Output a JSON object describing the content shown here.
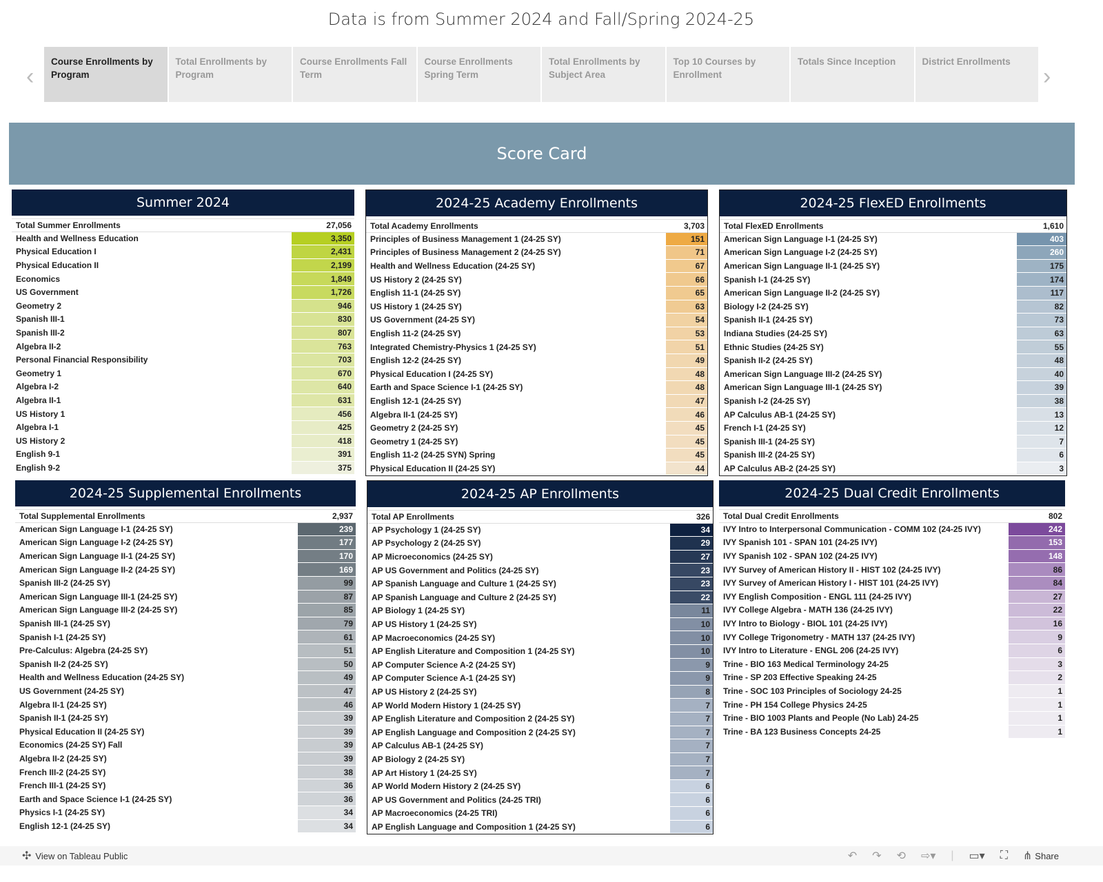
{
  "title": "Data is from Summer 2024 and Fall/Spring 2024-25",
  "tabs": [
    "Course Enrollments by Program",
    "Total Enrollments by Program",
    "Course Enrollments Fall Term",
    "Course Enrollments Spring Term",
    "Total Enrollments  by Subject Area",
    "Top 10 Courses by Enrollment",
    "Totals Since Inception",
    "District Enrollments"
  ],
  "banner": "Score Card",
  "colors": {
    "summer": [
      "#eef0de",
      "#b6cf22"
    ],
    "academy": [
      "#f2e3cc",
      "#eeaa44"
    ],
    "flexed": [
      "#eaedf1",
      "#7694ad"
    ],
    "supplemental": [
      "#dcdfe2",
      "#5c6870"
    ],
    "ap": [
      "#c8d2e0",
      "#0e2140"
    ],
    "dual": [
      "#eeebf1",
      "#7c4a9c"
    ]
  },
  "panels": [
    {
      "key": "summer",
      "title": "Summer 2024",
      "total_label": "Total Summer Enrollments",
      "total": "27,056",
      "rows": [
        [
          "Health and Wellness Education",
          "3,350"
        ],
        [
          "Physical Education I",
          "2,431"
        ],
        [
          "Physical Education II",
          "2,199"
        ],
        [
          "Economics",
          "1,849"
        ],
        [
          "US Government",
          "1,726"
        ],
        [
          "Geometry 2",
          "946"
        ],
        [
          "Spanish III-1",
          "830"
        ],
        [
          "Spanish III-2",
          "807"
        ],
        [
          "Algebra II-2",
          "763"
        ],
        [
          "Personal Financial Responsibility",
          "703"
        ],
        [
          "Geometry 1",
          "670"
        ],
        [
          "Algebra I-2",
          "640"
        ],
        [
          "Algebra II-1",
          "631"
        ],
        [
          "US History 1",
          "456"
        ],
        [
          "Algebra I-1",
          "425"
        ],
        [
          "US History 2",
          "418"
        ],
        [
          "English 9-1",
          "391"
        ],
        [
          "English 9-2",
          "375"
        ]
      ]
    },
    {
      "key": "academy",
      "title": "2024-25 Academy Enrollments",
      "total_label": "Total Academy Enrollments",
      "total": "3,703",
      "rows": [
        [
          "Principles of Business Management 1 (24-25 SY)",
          "151"
        ],
        [
          "Principles of Business Management 2 (24-25 SY)",
          "71"
        ],
        [
          "Health and Wellness Education (24-25 SY)",
          "67"
        ],
        [
          "US History 2 (24-25 SY)",
          "66"
        ],
        [
          "English 11-1 (24-25 SY)",
          "65"
        ],
        [
          "US History 1 (24-25 SY)",
          "63"
        ],
        [
          "US Government (24-25 SY)",
          "54"
        ],
        [
          "English 11-2 (24-25 SY)",
          "53"
        ],
        [
          "Integrated Chemistry-Physics 1 (24-25 SY)",
          "51"
        ],
        [
          "English 12-2 (24-25 SY)",
          "49"
        ],
        [
          "Physical Education I (24-25 SY)",
          "48"
        ],
        [
          "Earth and Space Science I-1 (24-25 SY)",
          "48"
        ],
        [
          "English 12-1 (24-25 SY)",
          "47"
        ],
        [
          "Algebra II-1 (24-25 SY)",
          "46"
        ],
        [
          "Geometry 2 (24-25 SY)",
          "45"
        ],
        [
          "Geometry 1 (24-25 SY)",
          "45"
        ],
        [
          "English 11-2 (24-25 SYN) Spring",
          "45"
        ],
        [
          "Physical Education II (24-25 SY)",
          "44"
        ]
      ]
    },
    {
      "key": "flexed",
      "title": "2024-25 FlexED Enrollments",
      "total_label": "Total FlexED Enrollments",
      "total": "1,610",
      "rows": [
        [
          "American Sign Language I-1 (24-25 SY)",
          "403"
        ],
        [
          "American Sign Language I-2 (24-25 SY)",
          "260"
        ],
        [
          "American Sign Language II-1 (24-25 SY)",
          "175"
        ],
        [
          "Spanish I-1 (24-25 SY)",
          "174"
        ],
        [
          "American Sign Language II-2 (24-25 SY)",
          "117"
        ],
        [
          "Biology I-2 (24-25 SY)",
          "82"
        ],
        [
          "Spanish II-1 (24-25 SY)",
          "73"
        ],
        [
          "Indiana Studies (24-25 SY)",
          "63"
        ],
        [
          "Ethnic Studies (24-25 SY)",
          "55"
        ],
        [
          "Spanish II-2 (24-25 SY)",
          "48"
        ],
        [
          "American Sign Language III-2 (24-25 SY)",
          "40"
        ],
        [
          "American Sign Language III-1 (24-25 SY)",
          "39"
        ],
        [
          "Spanish I-2 (24-25 SY)",
          "38"
        ],
        [
          "AP Calculus AB-1 (24-25 SY)",
          "13"
        ],
        [
          "French I-1 (24-25 SY)",
          "12"
        ],
        [
          "Spanish III-1 (24-25 SY)",
          "7"
        ],
        [
          "Spanish III-2 (24-25 SY)",
          "6"
        ],
        [
          "AP Calculus AB-2 (24-25 SY)",
          "3"
        ]
      ]
    },
    {
      "key": "supplemental",
      "title": "2024-25 Supplemental Enrollments",
      "total_label": "Total Supplemental Enrollments",
      "total": "2,937",
      "rows": [
        [
          "American Sign Language I-1 (24-25 SY)",
          "239"
        ],
        [
          "American Sign Language I-2 (24-25 SY)",
          "177"
        ],
        [
          "American Sign Language II-1 (24-25 SY)",
          "170"
        ],
        [
          "American Sign Language II-2 (24-25 SY)",
          "169"
        ],
        [
          "Spanish III-2 (24-25 SY)",
          "99"
        ],
        [
          "American Sign Language III-1 (24-25 SY)",
          "87"
        ],
        [
          "American Sign Language III-2 (24-25 SY)",
          "85"
        ],
        [
          "Spanish III-1 (24-25 SY)",
          "79"
        ],
        [
          "Spanish I-1 (24-25 SY)",
          "61"
        ],
        [
          "Pre-Calculus: Algebra (24-25 SY)",
          "51"
        ],
        [
          "Spanish II-2 (24-25 SY)",
          "50"
        ],
        [
          "Health and Wellness Education (24-25 SY)",
          "49"
        ],
        [
          "US Government (24-25 SY)",
          "47"
        ],
        [
          "Algebra II-1 (24-25 SY)",
          "46"
        ],
        [
          "Spanish II-1 (24-25 SY)",
          "39"
        ],
        [
          "Physical Education II (24-25 SY)",
          "39"
        ],
        [
          "Economics (24-25 SY) Fall",
          "39"
        ],
        [
          "Algebra II-2 (24-25 SY)",
          "39"
        ],
        [
          "French III-2 (24-25 SY)",
          "38"
        ],
        [
          "French III-1 (24-25 SY)",
          "36"
        ],
        [
          "Earth and Space Science I-1 (24-25 SY)",
          "36"
        ],
        [
          "Physics I-1 (24-25 SY)",
          "34"
        ],
        [
          "English 12-1 (24-25 SY)",
          "34"
        ]
      ]
    },
    {
      "key": "ap",
      "title": "2024-25 AP Enrollments",
      "total_label": "Total AP Enrollments",
      "total": "326",
      "rows": [
        [
          "AP Psychology 1 (24-25 SY)",
          "34"
        ],
        [
          "AP Psychology 2 (24-25 SY)",
          "29"
        ],
        [
          "AP Microeconomics (24-25 SY)",
          "27"
        ],
        [
          "AP US Government and Politics (24-25 SY)",
          "23"
        ],
        [
          "AP Spanish Language and Culture 1 (24-25 SY)",
          "23"
        ],
        [
          "AP Spanish Language and Culture 2 (24-25 SY)",
          "22"
        ],
        [
          "AP Biology 1 (24-25 SY)",
          "11"
        ],
        [
          "AP US History 1 (24-25 SY)",
          "10"
        ],
        [
          "AP Macroeconomics (24-25 SY)",
          "10"
        ],
        [
          "AP English Literature and Composition 1 (24-25 SY)",
          "10"
        ],
        [
          "AP Computer Science A-2 (24-25 SY)",
          "9"
        ],
        [
          "AP Computer Science A-1 (24-25 SY)",
          "9"
        ],
        [
          "AP US History 2 (24-25 SY)",
          "8"
        ],
        [
          "AP World Modern History 1 (24-25 SY)",
          "7"
        ],
        [
          "AP English Literature and Composition 2 (24-25 SY)",
          "7"
        ],
        [
          "AP English Language and Composition 2 (24-25 SY)",
          "7"
        ],
        [
          "AP Calculus AB-1 (24-25 SY)",
          "7"
        ],
        [
          "AP Biology 2 (24-25 SY)",
          "7"
        ],
        [
          "AP Art History 1 (24-25 SY)",
          "7"
        ],
        [
          "AP World Modern History 2 (24-25 SY)",
          "6"
        ],
        [
          "AP US Government and Politics (24-25 TRI)",
          "6"
        ],
        [
          "AP Macroeconomics (24-25 TRI)",
          "6"
        ],
        [
          "AP English Language and Composition 1 (24-25 SY)",
          "6"
        ]
      ]
    },
    {
      "key": "dual",
      "title": "2024-25 Dual Credit Enrollments",
      "total_label": "Total Dual Credit Enrollments",
      "total": "802",
      "rows": [
        [
          "IVY Intro to Interpersonal Communication - COMM 102 (24-25 IVY)",
          "242"
        ],
        [
          "IVY Spanish 101 - SPAN 101 (24-25 IVY)",
          "153"
        ],
        [
          "IVY Spanish 102 - SPAN 102 (24-25 IVY)",
          "148"
        ],
        [
          "IVY Survey of American History II - HIST 102 (24-25 IVY)",
          "86"
        ],
        [
          "IVY Survey of American History I - HIST 101 (24-25 IVY)",
          "84"
        ],
        [
          "IVY English Composition - ENGL 111 (24-25 IVY)",
          "27"
        ],
        [
          "IVY College Algebra - MATH 136 (24-25 IVY)",
          "22"
        ],
        [
          "IVY Intro to Biology - BIOL 101 (24-25 IVY)",
          "16"
        ],
        [
          "IVY College Trigonometry - MATH 137 (24-25 IVY)",
          "9"
        ],
        [
          "IVY Intro to Literature - ENGL 206 (24-25 IVY)",
          "6"
        ],
        [
          "Trine - BIO 163 Medical Terminology 24-25",
          "3"
        ],
        [
          "Trine - SP 203 Effective Speaking 24-25",
          "2"
        ],
        [
          "Trine - SOC 103 Principles of Sociology 24-25",
          "1"
        ],
        [
          "Trine - PH 154 College Physics 24-25",
          "1"
        ],
        [
          "Trine - BIO 1003 Plants and People (No Lab) 24-25",
          "1"
        ],
        [
          "Trine - BA 123 Business Concepts 24-25",
          "1"
        ]
      ]
    }
  ],
  "toolbar": {
    "view_label": "View on Tableau Public",
    "share_label": "Share"
  }
}
